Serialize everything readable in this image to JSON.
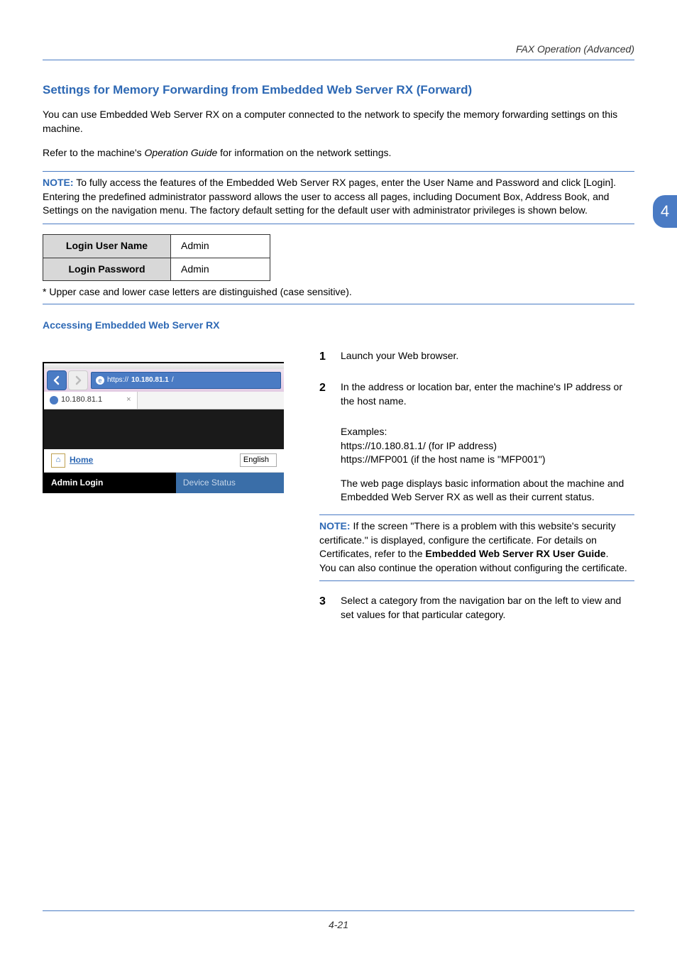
{
  "header": {
    "running_head": "FAX Operation (Advanced)"
  },
  "chapter_tab": "4",
  "section": {
    "title": "Settings for Memory Forwarding from Embedded Web Server RX (Forward)",
    "para1": "You can use Embedded Web Server RX on a computer connected to the network to specify the memory forwarding settings on this machine.",
    "para2_pre": "Refer to the machine's ",
    "para2_em": "Operation Guide",
    "para2_post": " for information on the network settings."
  },
  "note1": {
    "label": "NOTE:",
    "text": " To fully access the features of the Embedded Web Server RX pages, enter the User Name and Password and click [Login]. Entering the predefined administrator password allows the user to access all pages, including Document Box, Address Book, and Settings on the navigation menu. The factory default setting for the default user with administrator privileges is shown below."
  },
  "login_table": {
    "rows": [
      {
        "label": "Login User Name",
        "value": "Admin"
      },
      {
        "label": "Login Password",
        "value": "Admin"
      }
    ]
  },
  "footnote": "* Upper case and lower case letters are distinguished (case sensitive).",
  "subheading": "Accessing Embedded Web Server RX",
  "browser": {
    "url_prefix": "https://",
    "url_host": "10.180.81.1",
    "url_suffix": "/",
    "tab_title": "10.180.81.1",
    "home_label": "Home",
    "language": "English",
    "admin_login": "Admin Login",
    "device_status": "Device Status"
  },
  "steps": {
    "s1": {
      "num": "1",
      "text": "Launch your Web browser."
    },
    "s2": {
      "num": "2",
      "text": "In the address or location bar, enter the machine's IP address or the host name.",
      "examples_label": "Examples:",
      "ex1": "https://10.180.81.1/ (for IP address)",
      "ex2": "https://MFP001 (if the host name is \"MFP001\")",
      "para2": "The web page displays basic information about the machine and Embedded Web Server RX as well as their current status."
    },
    "s3": {
      "num": "3",
      "text": "Select a category from the navigation bar on the left to view and set values for that particular category."
    }
  },
  "note2": {
    "label": "NOTE:",
    "text1": " If the screen \"There is a problem with this website's security certificate.\" is displayed, configure the certificate. For details on Certificates, refer to the ",
    "bold": "Embedded Web Server RX User Guide",
    "text2": ".",
    "text3": "You can also continue the operation without configuring the certificate."
  },
  "footer": "4-21"
}
